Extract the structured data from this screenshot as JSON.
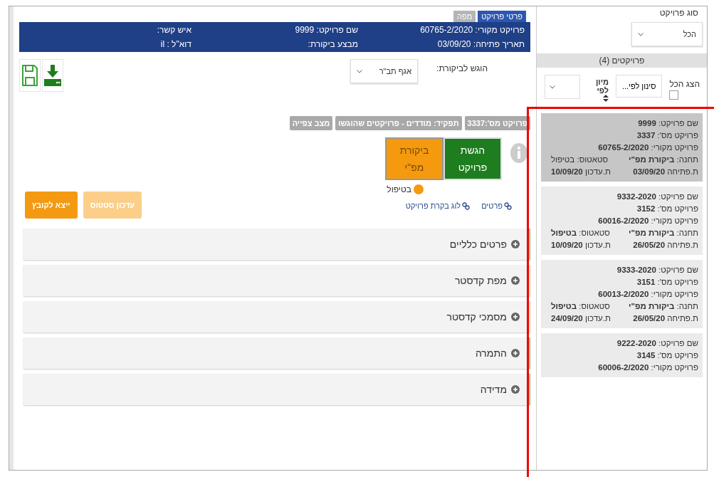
{
  "tabs": [
    {
      "label": "פרטי פרויקט",
      "selected": true
    },
    {
      "label": "מפה",
      "selected": false
    }
  ],
  "info_bar": {
    "rows": [
      [
        "פרויקט מקורי: 60765-2/2020",
        "שם פרויקט: 9999",
        "איש קשר:"
      ],
      [
        "תאריך פתיחה: 03/09/20",
        "מבצע ביקורת:",
        "דוא\"ל : il"
      ]
    ]
  },
  "submitted_to": {
    "label": "הוגש לביקורת:",
    "value": "אגף תב\"ר"
  },
  "tags": [
    "פרויקט מס':3337",
    "תפקיד: מודדים - פרויקטים שהוגשו",
    "מצב צפייה"
  ],
  "steps": [
    {
      "label": "הגשת פרויקט",
      "color": "#1e7d1e",
      "selected": false
    },
    {
      "label": "ביקורת מפ\"י",
      "color": "#f5990f",
      "selected": true
    }
  ],
  "status": {
    "label": "בטיפול",
    "color": "#f5990f"
  },
  "links": [
    "פרטים",
    "לוג בקרת פרויקט"
  ],
  "buttons": [
    {
      "label": "עדכון סטטוס",
      "disabled": true
    },
    {
      "label": "ייצא לקובץ",
      "disabled": false
    }
  ],
  "sections": [
    {
      "title": "פרטים כלליים",
      "color": "#8fdc8f"
    },
    {
      "title": "מפת קדסטר",
      "color": "#f6e59a"
    },
    {
      "title": "מסמכי קדסטר",
      "color": "#f6e59a"
    },
    {
      "title": "התמרה",
      "color": "#8fdc8f"
    },
    {
      "title": "מדידה",
      "color": "#8fdc8f"
    }
  ],
  "sidebar": {
    "filter_label": "סוג פרויקט",
    "filter_value": "הכל",
    "list_header": "פרויקטים (4)",
    "show_all": {
      "label": "הצג הכל",
      "checked": false
    },
    "filter_button": "סינון לפי...",
    "sort_label": "מיון לפי",
    "projects": [
      {
        "selected": true,
        "rows": [
          [
            "שם פרויקט: **9999**"
          ],
          [
            "פרויקט מס': **3337**"
          ],
          [
            "פרויקט מקורי: **60765-2/2020**"
          ],
          [
            "תחנה: **ביקורת מפ\"י**",
            "סטאטוס: בטיפול"
          ],
          [
            "ת.פתיחה **03/09/20**",
            "ת.עדכון **10/09/20**"
          ]
        ]
      },
      {
        "selected": false,
        "rows": [
          [
            "שם פרויקט: **9332-2020**"
          ],
          [
            "פרויקט מס': **3152**"
          ],
          [
            "פרויקט מקורי: **60016-2/2020**"
          ],
          [
            "תחנה: **ביקורת מפ\"י**",
            "סטאטוס: **בטיפול**"
          ],
          [
            "ת.פתיחה **26/05/20**",
            "ת.עדכון **10/09/20**"
          ]
        ]
      },
      {
        "selected": false,
        "rows": [
          [
            "שם פרויקט: **9333-2020**"
          ],
          [
            "פרויקט מס': **3151**"
          ],
          [
            "פרויקט מקורי: **60013-2/2020**"
          ],
          [
            "תחנה: **ביקורת מפ\"י**",
            "סטאטוס: **בטיפול**"
          ],
          [
            "ת.פתיחה **26/05/20**",
            "ת.עדכון **24/09/20**"
          ]
        ]
      },
      {
        "selected": false,
        "rows": [
          [
            "שם פרויקט: **9222-2020**"
          ],
          [
            "פרויקט מס': **3145**"
          ],
          [
            "פרויקט מקורי: **60006-2/2020**"
          ]
        ]
      }
    ]
  }
}
